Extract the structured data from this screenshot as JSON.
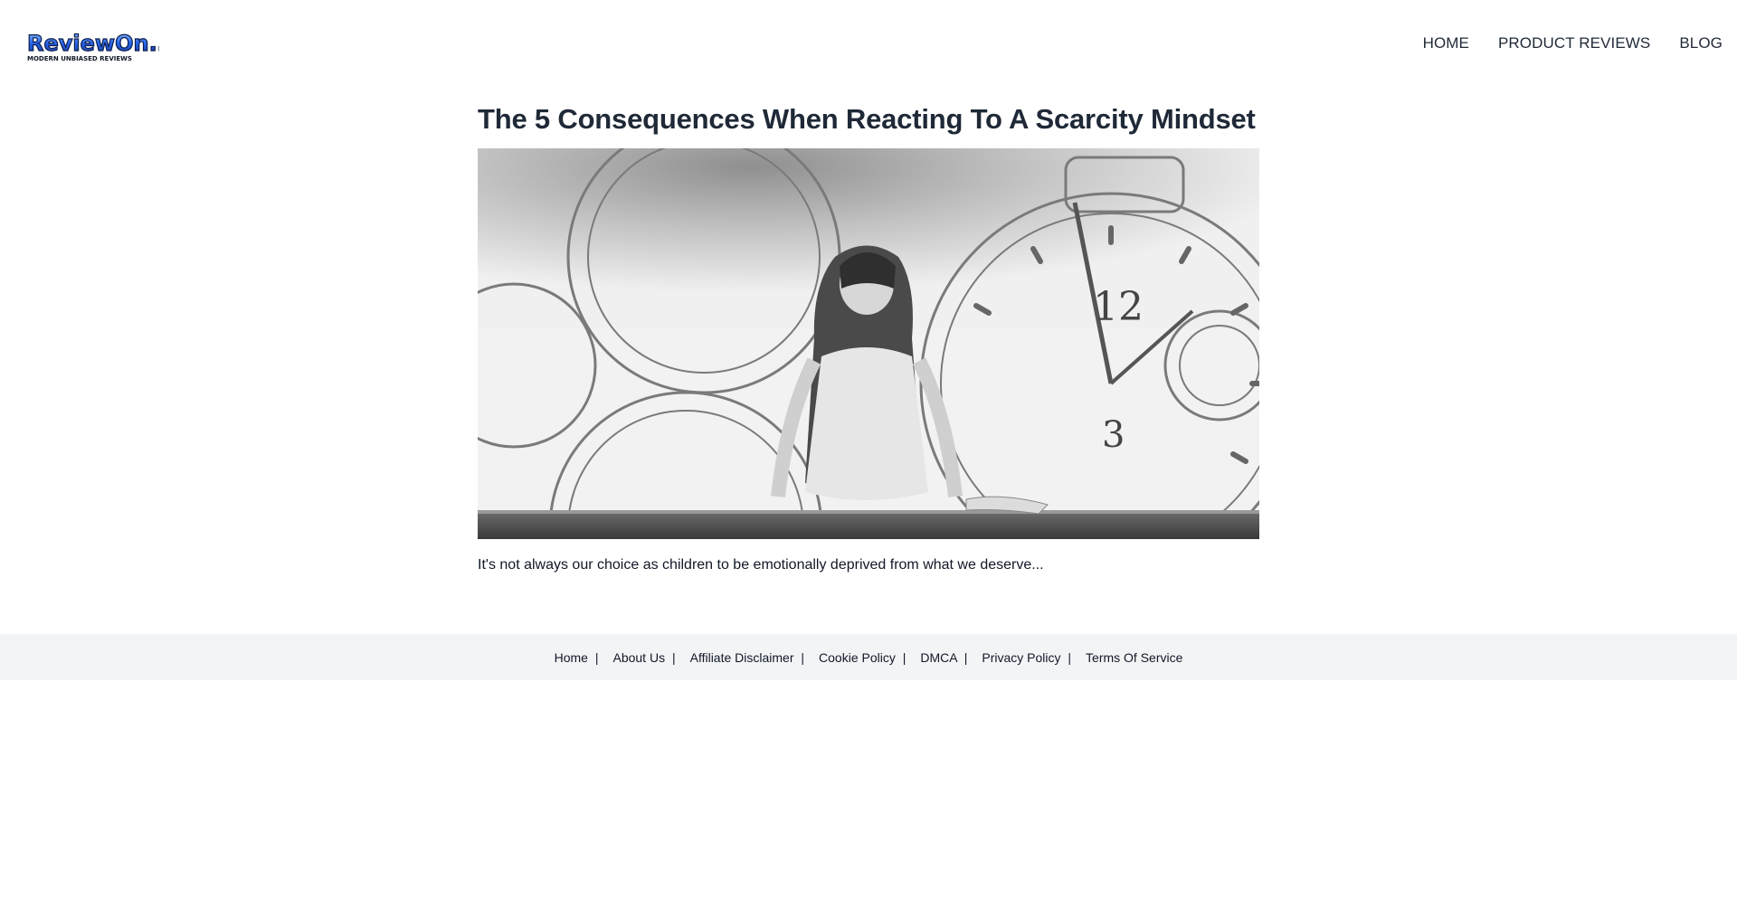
{
  "header": {
    "logo_text": "ReviewOn...",
    "logo_tagline": "MODERN UNBIASED REVIEWS",
    "nav": [
      {
        "label": "HOME"
      },
      {
        "label": "PRODUCT REVIEWS"
      },
      {
        "label": "BLOG"
      }
    ]
  },
  "post": {
    "title": "The 5 Consequences When Reacting To A Scarcity Mindset",
    "image_alt": "woman sitting on ledge in front of clock faces",
    "excerpt": "It's not always our choice as children to be emotionally deprived from what we deserve..."
  },
  "footer": {
    "links": [
      {
        "label": "Home",
        "sep": "|"
      },
      {
        "label": "About Us",
        "sep": "|"
      },
      {
        "label": "Affiliate Disclaimer",
        "sep": "|"
      },
      {
        "label": "Cookie Policy",
        "sep": "|"
      },
      {
        "label": "DMCA",
        "sep": "|"
      },
      {
        "label": "Privacy Policy",
        "sep": "|"
      },
      {
        "label": "Terms Of Service",
        "sep": ""
      }
    ]
  },
  "colors": {
    "logo_blue": "#1d4ed8",
    "text": "#1f2937",
    "footer_bg": "#f3f4f6"
  }
}
